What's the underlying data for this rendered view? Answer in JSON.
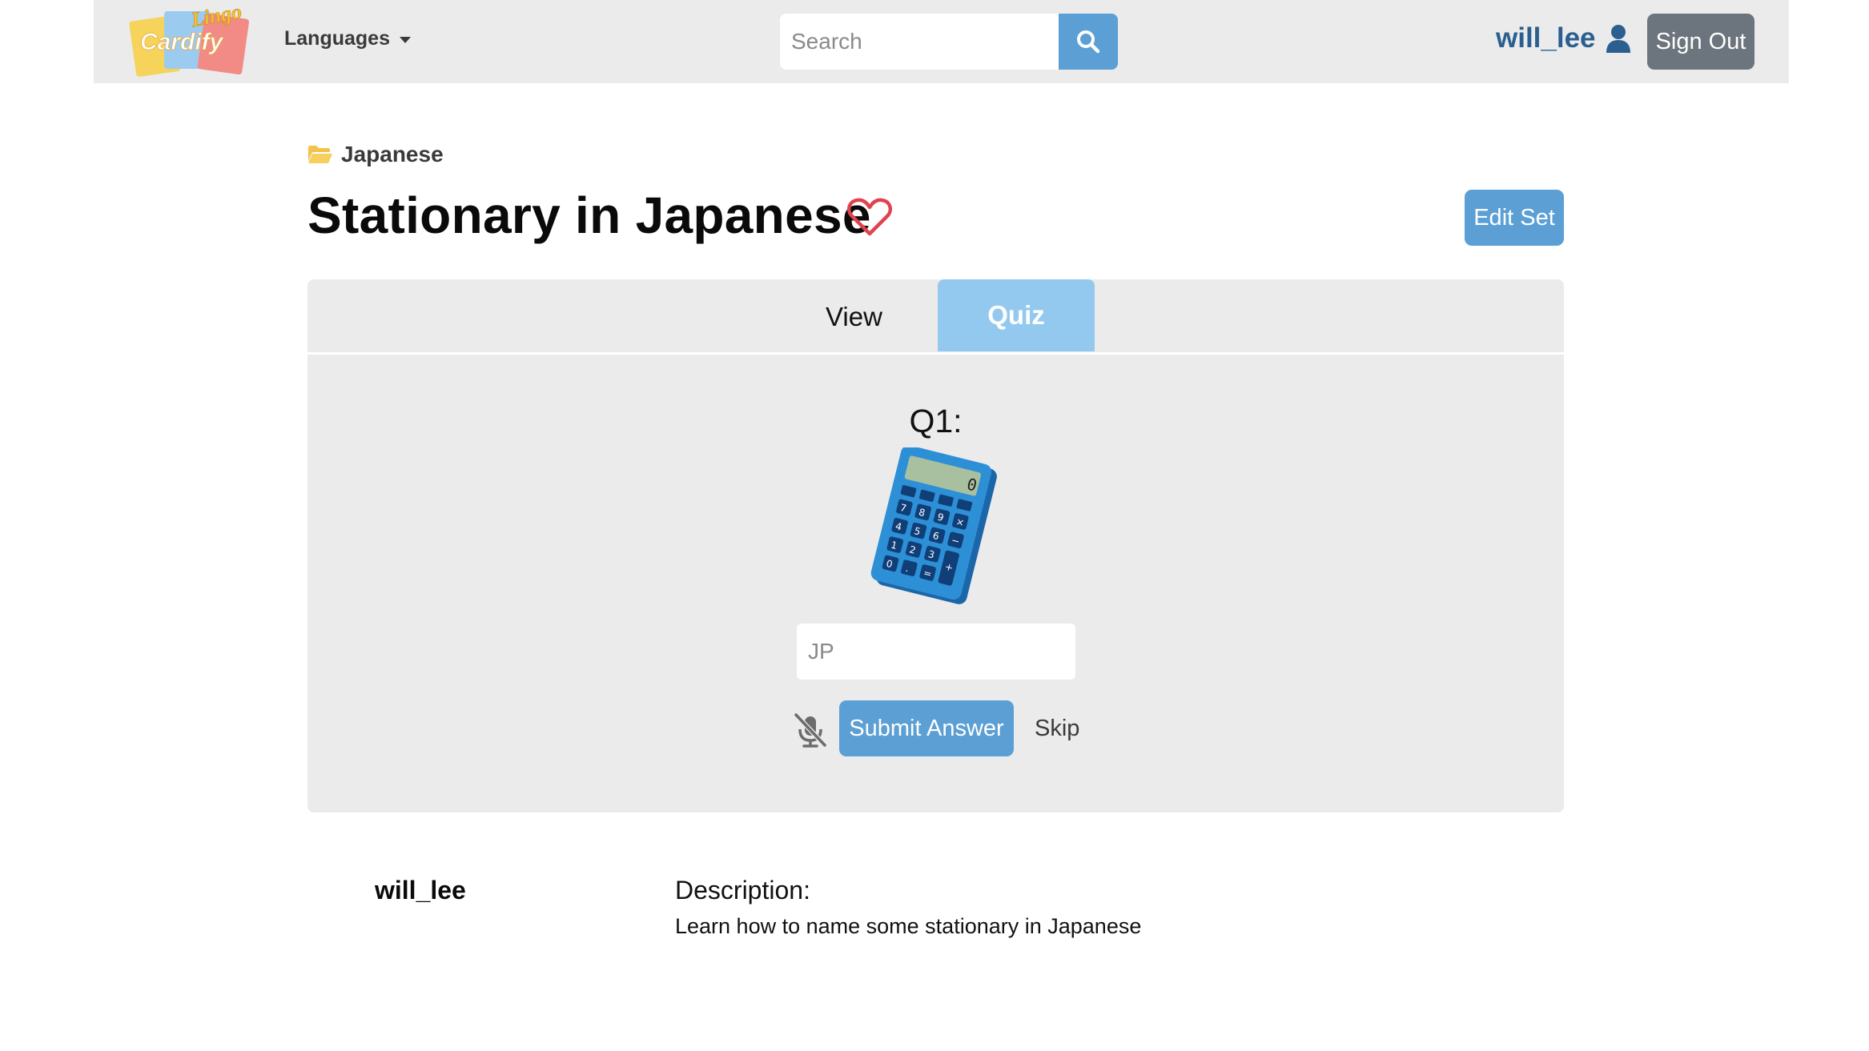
{
  "navbar": {
    "logo_text": "Cardify",
    "logo_subtext": "Lingo",
    "languages_label": "Languages",
    "search_placeholder": "Search",
    "username": "will_lee",
    "signout_label": "Sign Out",
    "icons": {
      "search": "search-icon",
      "user": "user-icon",
      "caret": "caret-down-icon"
    }
  },
  "breadcrumb": {
    "folder_icon": "folder-open-icon",
    "label": "Japanese"
  },
  "set": {
    "title": "Stationary in Japanese",
    "favorite_icon": "heart-outline-icon",
    "edit_label": "Edit Set"
  },
  "tabs": [
    {
      "label": "View",
      "active": false
    },
    {
      "label": "Quiz",
      "active": true
    }
  ],
  "quiz": {
    "question_label": "Q1:",
    "image_icon": "calculator-icon",
    "answer_placeholder": "JP",
    "mic_icon": "microphone-muted-icon",
    "submit_label": "Submit Answer",
    "skip_label": "Skip"
  },
  "details": {
    "author": "will_lee",
    "description_label": "Description:",
    "description_text": "Learn how to name some stationary in Japanese"
  },
  "colors": {
    "navbar_bg": "#ebebeb",
    "primary": "#5b9fd4",
    "active_tab": "#93c9ef",
    "secondary": "#6c757d",
    "heart": "#e0434f",
    "username": "#2a5f8f"
  }
}
